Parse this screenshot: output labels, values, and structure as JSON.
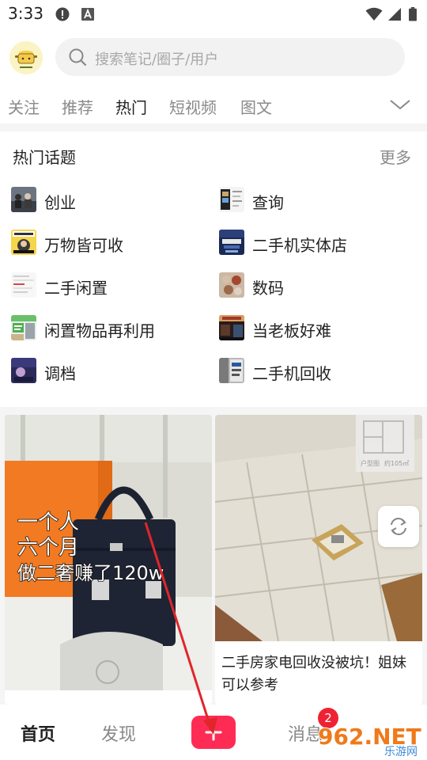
{
  "status_bar": {
    "time": "3:33",
    "icons": [
      "alert-circle-icon",
      "a-box-icon",
      "wifi-icon",
      "signal-icon",
      "battery-icon"
    ]
  },
  "search": {
    "placeholder": "搜索笔记/圈子/用户"
  },
  "tabs": [
    {
      "label": "关注",
      "active": false
    },
    {
      "label": "推荐",
      "active": false
    },
    {
      "label": "热门",
      "active": true
    },
    {
      "label": "短视频",
      "active": false
    },
    {
      "label": "图文",
      "active": false
    }
  ],
  "topics": {
    "title": "热门话题",
    "more": "更多",
    "items": [
      {
        "label": "创业"
      },
      {
        "label": "查询"
      },
      {
        "label": "万物皆可收"
      },
      {
        "label": "二手机实体店"
      },
      {
        "label": "二手闲置"
      },
      {
        "label": "数码"
      },
      {
        "label": "闲置物品再利用"
      },
      {
        "label": "当老板好难"
      },
      {
        "label": "调档"
      },
      {
        "label": "二手机回收"
      }
    ]
  },
  "feed": {
    "cards": [
      {
        "overlay_lines": [
          "一个人",
          "六个月",
          "做二奢赚了120w"
        ],
        "caption": ""
      },
      {
        "floorplan_label": "户型图",
        "floorplan_area": "约105㎡",
        "caption": "二手房家电回收没被坑！姐妹可以参考"
      }
    ]
  },
  "bottom_nav": {
    "home": "首页",
    "discover": "发现",
    "messages": "消息",
    "messages_badge": "2",
    "add_icon": "plus-icon"
  },
  "watermark": {
    "text": "962.NET",
    "subtext": "乐游网"
  },
  "colors": {
    "accent": "#fe2c55",
    "badge": "#ee2233",
    "annotation_arrow": "#e0262b"
  }
}
